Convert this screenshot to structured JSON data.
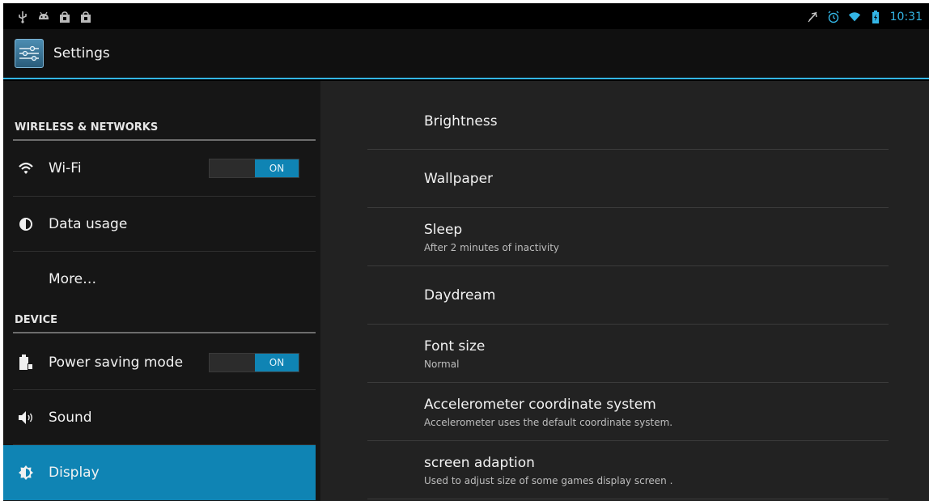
{
  "status_bar": {
    "left_icons": [
      "usb-icon",
      "android-debug-icon",
      "bag-icon",
      "bag-icon"
    ],
    "right_icons": [
      "mute-icon",
      "alarm-icon",
      "wifi-icon",
      "battery-icon"
    ],
    "time": "10:31"
  },
  "action_bar": {
    "title": "Settings"
  },
  "sidebar": {
    "sections": [
      {
        "header": "WIRELESS & NETWORKS"
      },
      {
        "header": "DEVICE"
      }
    ],
    "items": [
      {
        "label": "Wi-Fi",
        "icon": "wifi-icon",
        "toggle": "ON"
      },
      {
        "label": "Data usage",
        "icon": "data-usage-icon"
      },
      {
        "label": "More…"
      },
      {
        "label": "Power saving mode",
        "icon": "battery-icon",
        "toggle": "ON"
      },
      {
        "label": "Sound",
        "icon": "speaker-icon"
      },
      {
        "label": "Display",
        "icon": "brightness-icon",
        "selected": true
      }
    ]
  },
  "display_settings": [
    {
      "title": "Brightness"
    },
    {
      "title": "Wallpaper"
    },
    {
      "title": "Sleep",
      "summary": "After 2 minutes of inactivity"
    },
    {
      "title": "Daydream"
    },
    {
      "title": "Font size",
      "summary": "Normal"
    },
    {
      "title": "Accelerometer coordinate system",
      "summary": "Accelerometer uses the default coordinate system."
    },
    {
      "title": "screen adaption",
      "summary": "Used to adjust size of some games display screen ."
    }
  ],
  "colors": {
    "accent": "#33b5e5",
    "selected": "#0f84b4"
  }
}
